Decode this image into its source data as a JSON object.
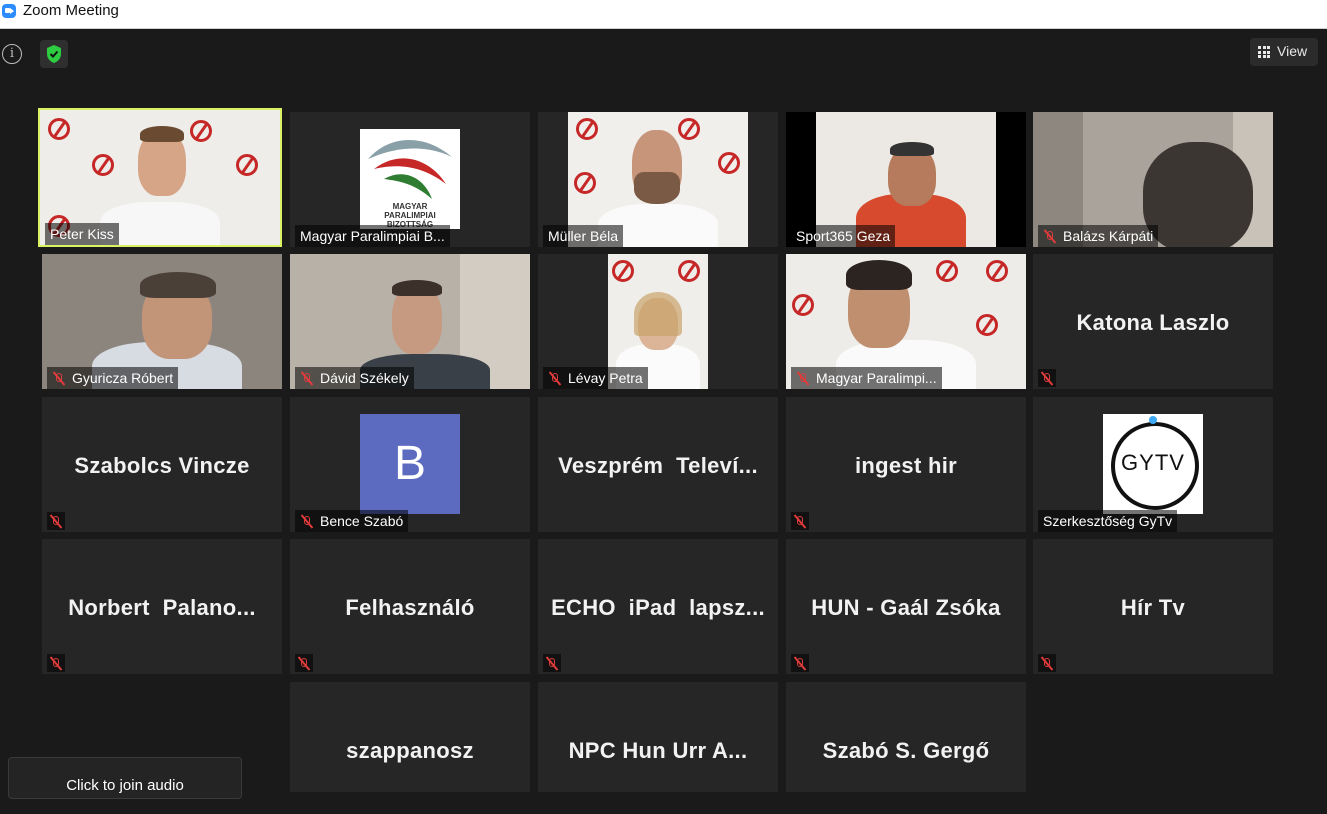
{
  "window": {
    "title": "Zoom Meeting"
  },
  "toolbar": {
    "view_label": "View"
  },
  "tiles": [
    {
      "name": "Peter Kiss",
      "muted": false
    },
    {
      "name": "Magyar Paralimpiai B...",
      "muted": false
    },
    {
      "name": "Müller Béla",
      "muted": false
    },
    {
      "name": "Sport365 Geza",
      "muted": false
    },
    {
      "name": "Balázs Kárpáti",
      "muted": true
    },
    {
      "name": "Gyuricza Róbert",
      "muted": true
    },
    {
      "name": "Dávid Székely",
      "muted": true
    },
    {
      "name": "Lévay Petra",
      "muted": true
    },
    {
      "name": "Magyar Paralimpi...",
      "muted": true
    },
    {
      "name": "Katona Laszlo",
      "muted": true
    },
    {
      "name": "Szabolcs Vincze",
      "muted": true
    },
    {
      "name": "Bence Szabó",
      "muted": true,
      "avatar_letter": "B"
    },
    {
      "name": "Veszprém  Televí...",
      "muted": false
    },
    {
      "name": "ingest hir",
      "muted": true
    },
    {
      "name": "Szerkesztőség GyTv",
      "muted": false,
      "logo_text": "GYTV"
    },
    {
      "name": "Norbert  Palano...",
      "muted": true
    },
    {
      "name": "Felhasználó",
      "muted": true
    },
    {
      "name": "ECHO  iPad  lapsz...",
      "muted": true
    },
    {
      "name": "HUN - Gaál Zsóka",
      "muted": true
    },
    {
      "name": "Hír Tv",
      "muted": true
    },
    {
      "name": "szappanosz",
      "muted": false
    },
    {
      "name": "NPC Hun Urr A...",
      "muted": false
    },
    {
      "name": "Szabó S. Gergő",
      "muted": false
    }
  ],
  "logo_texts": {
    "mpb_line1": "MAGYAR",
    "mpb_line2": "PARALIMPIAI",
    "mpb_line3": "BIZOTTSÁG"
  },
  "audio": {
    "join_label": "Click to join audio"
  },
  "colors": {
    "active_speaker": "#d9f264",
    "muted_icon": "#e23b3b",
    "avatar_bg": "#5c6bc0"
  }
}
